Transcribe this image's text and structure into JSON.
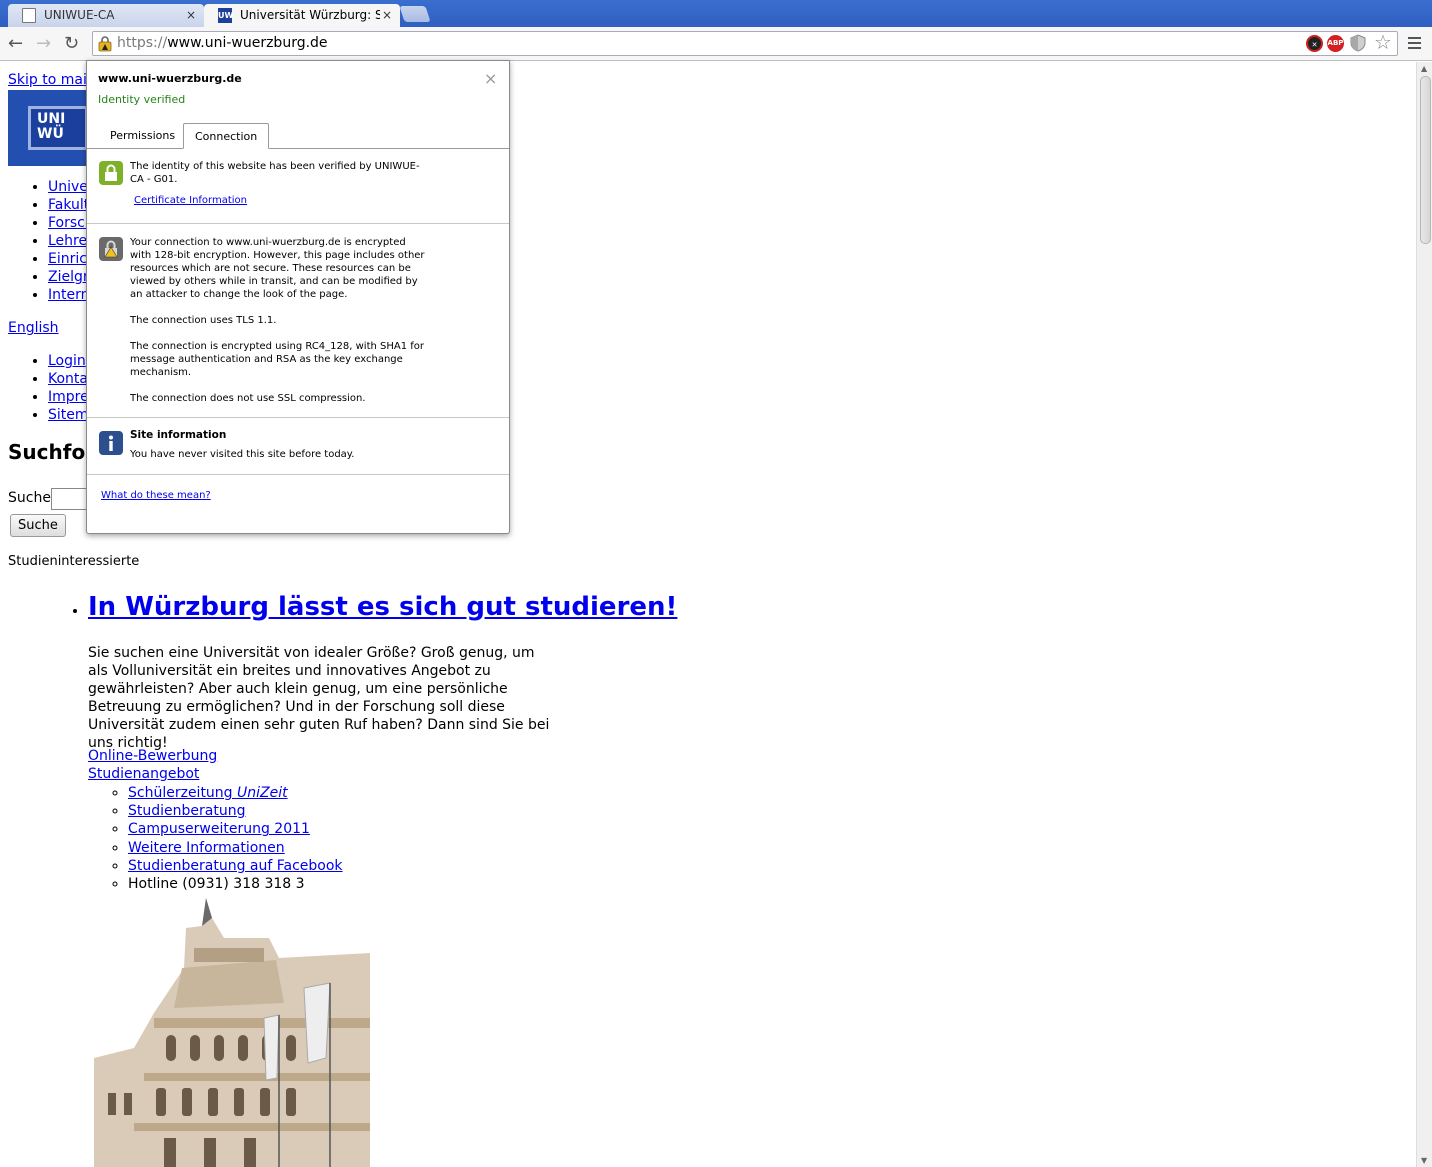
{
  "browser": {
    "tabs": [
      {
        "title": "UNIWUE-CA",
        "close": "×"
      },
      {
        "title": "Universität Würzburg: Sta",
        "close": "×",
        "favicon": "UW"
      }
    ],
    "url_scheme": "https://",
    "url_host": "www.uni-wuerzburg.de",
    "extensions": [
      "red-blocker-icon",
      "adblock-plus-icon",
      "shield-icon"
    ],
    "abp_label": "ABP"
  },
  "page": {
    "skip_link": "Skip to main",
    "logo_text": "UNI\nWÜ",
    "nav_primary": [
      "Unive",
      "Fakult",
      "Forsch",
      "Lehre",
      "Einrich",
      "Zielgr",
      "Intern"
    ],
    "language_link": "English",
    "nav_secondary": [
      "Login",
      "Konta",
      "Impre",
      "Sitem"
    ],
    "search_heading": "Suchfor",
    "search_label": "Suche",
    "search_button": "Suche",
    "section_label": "Studieninteressierte",
    "headline": "In Würzburg lässt es sich gut studieren!",
    "intro": "Sie suchen eine Universität von idealer Größe? Groß genug, um als Volluniversität ein breites und innovatives Angebot zu gewährleisten? Aber auch klein genug, um eine persönliche Betreuung zu ermöglichen? Und in der Forschung soll diese Universität zudem einen sehr guten Ruf haben? Dann sind Sie bei uns richtig!",
    "link_bewerbung": "Online-Bewerbung",
    "link_angebot": "Studienangebot",
    "sub_links": {
      "schuelerzeitung": "Schülerzeitung ",
      "schuelerzeitung_em": "UniZeit",
      "studienberatung": "Studienberatung",
      "campus": "Campuserweiterung 2011",
      "weitere": "Weitere Informationen",
      "facebook": "Studienberatung auf Facebook",
      "hotline": "Hotline (0931) 318 318 3"
    }
  },
  "popup": {
    "host": "www.uni-wuerzburg.de",
    "identity": "Identity verified",
    "close": "×",
    "tab_permissions": "Permissions",
    "tab_connection": "Connection",
    "identity_text": "The identity of this website has been verified by UNIWUE-CA - G01.",
    "certificate_link": "Certificate Information",
    "connection_text_1": "Your connection to www.uni-wuerzburg.de is encrypted with 128-bit encryption. However, this page includes other resources which are not secure. These resources can be viewed by others while in transit, and can be modified by an attacker to change the look of the page.",
    "connection_text_2": "The connection uses TLS 1.1.",
    "connection_text_3": "The connection is encrypted using RC4_128, with SHA1 for message authentication and RSA as the key exchange mechanism.",
    "connection_text_4": "The connection does not use SSL compression.",
    "site_info_title": "Site information",
    "site_info_text": "You have never visited this site before today.",
    "help_link": "What do these mean?"
  },
  "colors": {
    "tabstrip": "#3a6fcf",
    "link": "#0000ee",
    "verified_green": "#25831a",
    "lock_green": "#7fb02a",
    "warning_grey": "#6a6a6a",
    "info_blue": "#2d4f8e"
  }
}
